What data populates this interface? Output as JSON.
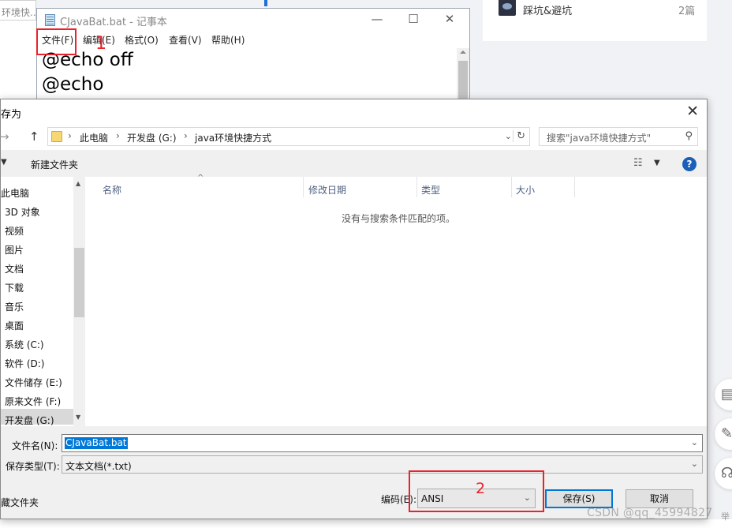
{
  "background": {
    "left_input": "环境快...",
    "card": {
      "title": "踩坑&避坑",
      "count": "2篇"
    },
    "side_icons": [
      "clipboard-icon",
      "edit-icon",
      "headset-icon"
    ],
    "watermark": "CSDN @qq_45994827",
    "watermark_tail": "举"
  },
  "notepad": {
    "title": "CJavaBat.bat - 记事本",
    "controls": {
      "minimize": "—",
      "maximize": "☐",
      "close": "✕"
    },
    "menu": [
      "文件(F)",
      "编辑(E)",
      "格式(O)",
      "查看(V)",
      "帮助(H)"
    ],
    "lines": [
      "@echo off",
      "@echo"
    ]
  },
  "annotations": {
    "first": "1",
    "second": "2"
  },
  "dialog": {
    "title": "存为",
    "close": "✕",
    "breadcrumb": [
      "此电脑",
      "开发盘 (G:)",
      "java环境快捷方式"
    ],
    "search_placeholder": "搜索\"java环境快捷方式\"",
    "toolbar": {
      "new_folder": "新建文件夹",
      "help": "?"
    },
    "nav_items": [
      "此电脑",
      "3D 对象",
      "视频",
      "图片",
      "文档",
      "下载",
      "音乐",
      "桌面",
      "系统 (C:)",
      "软件 (D:)",
      "文件储存 (E:)",
      "原来文件 (F:)",
      "开发盘 (G:)"
    ],
    "columns": [
      "名称",
      "修改日期",
      "类型",
      "大小"
    ],
    "empty_message": "没有与搜索条件匹配的项。",
    "filename_label": "文件名(N):",
    "filename_value": "CJavaBat.bat",
    "filetype_label": "保存类型(T):",
    "filetype_value": "文本文档(*.txt)",
    "hide_folders": "藏文件夹",
    "encoding_label": "编码(E):",
    "encoding_value": "ANSI",
    "save_button": "保存(S)",
    "cancel_button": "取消"
  }
}
